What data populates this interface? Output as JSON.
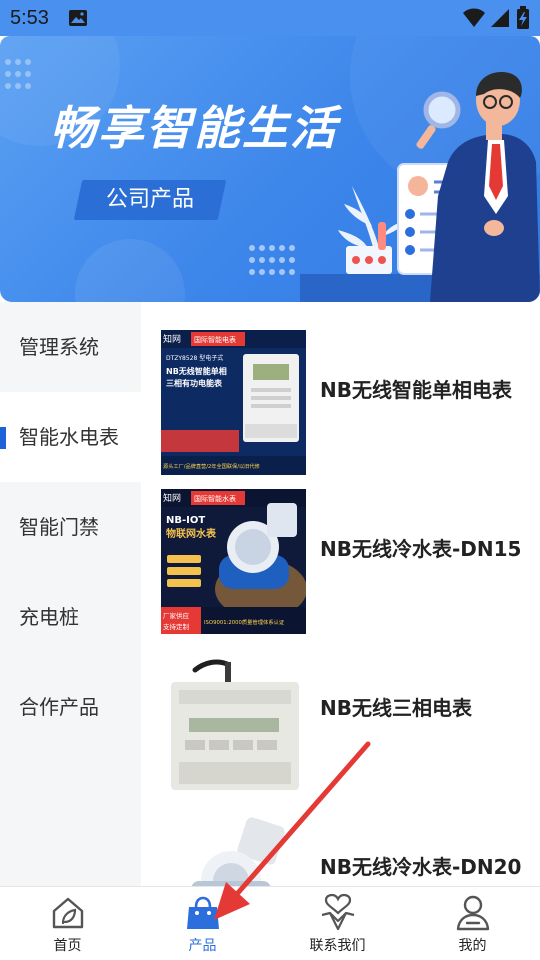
{
  "status_bar": {
    "time": "5:53",
    "icons": [
      "image-icon",
      "wifi-icon",
      "signal-icon",
      "battery-charging-icon"
    ]
  },
  "banner": {
    "title": "畅享智能生活",
    "tag": "公司产品"
  },
  "sidebar": {
    "items": [
      {
        "label": "管理系统",
        "active": false
      },
      {
        "label": "智能水电表",
        "active": true
      },
      {
        "label": "智能门禁",
        "active": false
      },
      {
        "label": "充电桩",
        "active": false
      },
      {
        "label": "合作产品",
        "active": false
      }
    ]
  },
  "products": [
    {
      "name": "NB无线智能单相电表",
      "thumb": {
        "brand": "知网",
        "badge": "国际智能电表",
        "model": "DTZY8528 型电子式",
        "line1": "NB无线智能单相",
        "line2": "三相有功电能表",
        "footer": "源头工厂/品牌直营/2年全国联保/以旧代修"
      }
    },
    {
      "name": "NB无线冷水表-DN15",
      "thumb": {
        "brand": "知网",
        "badge": "国际智能水表",
        "line1": "NB-IOT",
        "line2": "物联网水表",
        "bottom_left1": "厂家供应",
        "bottom_left2": "支持定制",
        "footer": "ISO9001:2000质量管理体系认证"
      }
    },
    {
      "name": "NB无线三相电表",
      "thumb": {}
    },
    {
      "name": "NB无线冷水表-DN20",
      "thumb": {}
    }
  ],
  "bottom_nav": {
    "items": [
      {
        "label": "首页",
        "icon": "home-icon",
        "active": false
      },
      {
        "label": "产品",
        "icon": "shopping-bag-icon",
        "active": true
      },
      {
        "label": "联系我们",
        "icon": "handshake-heart-icon",
        "active": false
      },
      {
        "label": "我的",
        "icon": "user-icon",
        "active": false
      }
    ]
  },
  "colors": {
    "primary": "#2c6fdc",
    "banner": "#3d86ea",
    "sidebar_bg": "#f5f6f8",
    "annotation": "#e53935"
  }
}
